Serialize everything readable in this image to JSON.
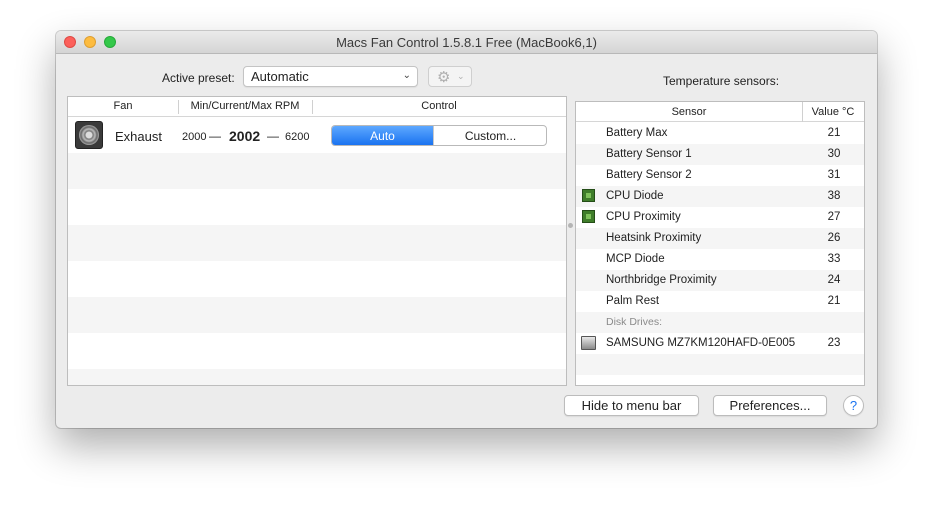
{
  "window": {
    "title": "Macs Fan Control 1.5.8.1 Free (MacBook6,1)"
  },
  "toolbar": {
    "preset_label": "Active preset:",
    "preset_value": "Automatic",
    "gear_icon": "gear-icon"
  },
  "fans": {
    "headers": {
      "fan": "Fan",
      "rpm": "Min/Current/Max RPM",
      "control": "Control"
    },
    "rows": [
      {
        "name": "Exhaust",
        "min": "2000",
        "current": "2002",
        "max": "6200",
        "dash": "—",
        "control_auto": "Auto",
        "control_custom": "Custom..."
      }
    ]
  },
  "sensors": {
    "title": "Temperature sensors:",
    "headers": {
      "sensor": "Sensor",
      "value": "Value °C"
    },
    "rows": [
      {
        "name": "Battery Max",
        "value": "21",
        "icon": ""
      },
      {
        "name": "Battery Sensor 1",
        "value": "30",
        "icon": ""
      },
      {
        "name": "Battery Sensor 2",
        "value": "31",
        "icon": ""
      },
      {
        "name": "CPU Diode",
        "value": "38",
        "icon": "chip-icon"
      },
      {
        "name": "CPU Proximity",
        "value": "27",
        "icon": "chip-icon"
      },
      {
        "name": "Heatsink Proximity",
        "value": "26",
        "icon": ""
      },
      {
        "name": "MCP Diode",
        "value": "33",
        "icon": ""
      },
      {
        "name": "Northbridge Proximity",
        "value": "24",
        "icon": ""
      },
      {
        "name": "Palm Rest",
        "value": "21",
        "icon": ""
      }
    ],
    "disk_group_label": "Disk Drives:",
    "disk_rows": [
      {
        "name": "SAMSUNG MZ7KM120HAFD-0E005",
        "value": "23",
        "icon": "disk-icon"
      }
    ]
  },
  "footer": {
    "hide_label": "Hide to menu bar",
    "preferences_label": "Preferences...",
    "help_label": "?"
  },
  "colors": {
    "accent": "#1a73f0",
    "close": "#fc605b",
    "minimize": "#fdbc40",
    "maximize": "#34c84a"
  }
}
